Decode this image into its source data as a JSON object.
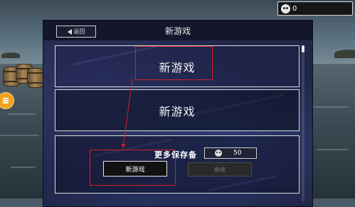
{
  "hud": {
    "coin_count": "0"
  },
  "dialog": {
    "title": "新游戏",
    "back_label": "返回",
    "slots": [
      {
        "label": "新游戏"
      },
      {
        "label": "新游戏"
      }
    ],
    "more_saves_label": "更多保存备",
    "more_saves_cost": "50",
    "buttons": {
      "new_game": "新游戏",
      "continue": "继续"
    }
  },
  "annotation": {
    "color": "#d21f26"
  }
}
